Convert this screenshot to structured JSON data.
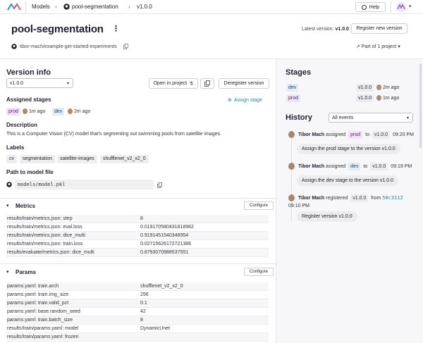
{
  "nav": {
    "models": "Models",
    "model_name": "pool-segmentation",
    "version": "v1.0.0",
    "help": "Help"
  },
  "header": {
    "title": "pool-segmentation",
    "repo": "tibor-mach/example-get-started-experiments",
    "latest_version_label": "Latest version:",
    "latest_version_value": "v1.0.0",
    "register_button": "Register new version",
    "part_of": "Part of 1 project"
  },
  "version_info": {
    "heading": "Version info",
    "selected_version": "v1.0.0",
    "open_in_project": "Open in project",
    "deregister": "Deregister version",
    "assigned_stages_heading": "Assigned stages",
    "assign_stage": "Assign stage",
    "stages": [
      {
        "name": "prod",
        "time": "1m ago"
      },
      {
        "name": "dev",
        "time": "2m ago"
      }
    ],
    "description_heading": "Description",
    "description": "This is a Computer Vision (CV) model that's segmenting out swimming pools from satellite images.",
    "labels_heading": "Labels",
    "labels": [
      "cv",
      "segmentation",
      "satellite-images",
      "shufflenet_v2_x2_0"
    ],
    "path_heading": "Path to model file",
    "path": "models/model.pkl"
  },
  "metrics": {
    "heading": "Metrics",
    "configure": "Configure",
    "rows": [
      {
        "key": "results/train/metrics.json: step",
        "value": "8"
      },
      {
        "key": "results/train/metrics.json: eval.loss",
        "value": "0.019170580431818962"
      },
      {
        "key": "results/train/metrics.json: dice_multi",
        "value": "0.9191451540348954"
      },
      {
        "key": "results/train/metrics.json: train.loss",
        "value": "0.02715626172721386"
      },
      {
        "key": "results/evaluate/metrics.json: dice_multi",
        "value": "0.8793070988537551"
      }
    ]
  },
  "params": {
    "heading": "Params",
    "configure": "Configure",
    "rows": [
      {
        "key": "params.yaml: train.arch",
        "value": "shufflenet_v2_x2_0"
      },
      {
        "key": "params.yaml: train.img_size",
        "value": "256"
      },
      {
        "key": "params.yaml: train.valid_pct",
        "value": "0.1"
      },
      {
        "key": "params.yaml: base.random_seed",
        "value": "42"
      },
      {
        "key": "params.yaml: train.batch_size",
        "value": "8"
      },
      {
        "key": "results/train/params.yaml: model",
        "value": "DynamicUnet"
      },
      {
        "key": "results/train/params.yaml: frozen",
        "value": ""
      }
    ]
  },
  "stages_panel": {
    "heading": "Stages",
    "rows": [
      {
        "stage": "dev",
        "version": "v1.0.0",
        "time": "2m ago"
      },
      {
        "stage": "prod",
        "version": "v1.0.0",
        "time": "1m ago"
      }
    ]
  },
  "history": {
    "heading": "History",
    "filter": "All events",
    "events": [
      {
        "user": "Tibor Mach",
        "action": "assigned",
        "stage": "prod",
        "to": "to",
        "version": "v1.0.0",
        "time": "09:20 PM",
        "message": "Assign the prod stage to the version v1.0.0"
      },
      {
        "user": "Tibor Mach",
        "action": "assigned",
        "stage": "dev",
        "to": "to",
        "version": "v1.0.0",
        "time": "09:19 PM",
        "message": "Assign the dev stage to the version v1.0.0"
      },
      {
        "user": "Tibor Mach",
        "action": "registered",
        "version": "v1.0.0",
        "from": "from",
        "commit": "50c3112",
        "time": "09:10 PM",
        "message": "Register version v1.0.0"
      }
    ]
  },
  "colors": {
    "prod_tag": "#efe3f4",
    "dev_tag": "#e2ecf6",
    "link": "#1a8a9d"
  }
}
